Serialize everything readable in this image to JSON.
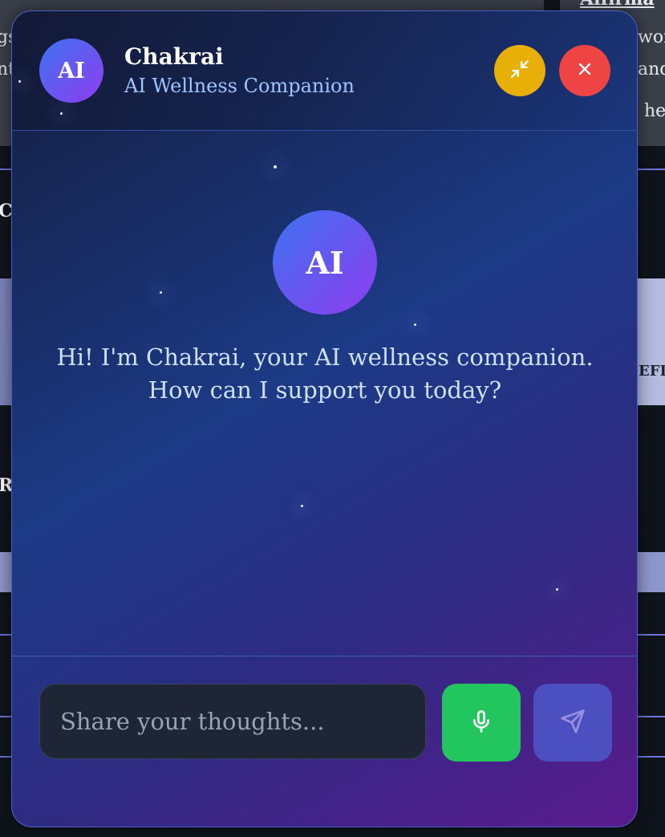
{
  "background": {
    "fragments": [
      "Affirma",
      "wor",
      "gs",
      "nt",
      "and",
      "he",
      "C",
      "EFI",
      "R"
    ]
  },
  "chat": {
    "avatar_label": "AI",
    "title": "Chakrai",
    "subtitle": "AI Wellness Companion",
    "minimize_icon": "minimize-arrows-icon",
    "close_icon": "close-x-icon",
    "greeting_avatar_label": "AI",
    "greeting": "Hi! I'm Chakrai, your AI wellness companion. How can I support you today?",
    "input_placeholder": "Share your thoughts...",
    "input_value": "",
    "mic_icon": "microphone-icon",
    "send_icon": "send-paper-plane-icon"
  },
  "colors": {
    "minimize_button": "#e8b007",
    "close_button": "#ef4444",
    "mic_button": "#22c55e",
    "send_button": "#4b4fc0",
    "avatar_gradient_start": "#3d73f0",
    "avatar_gradient_end": "#8f3cf0",
    "subtitle": "#9fc4ff"
  }
}
